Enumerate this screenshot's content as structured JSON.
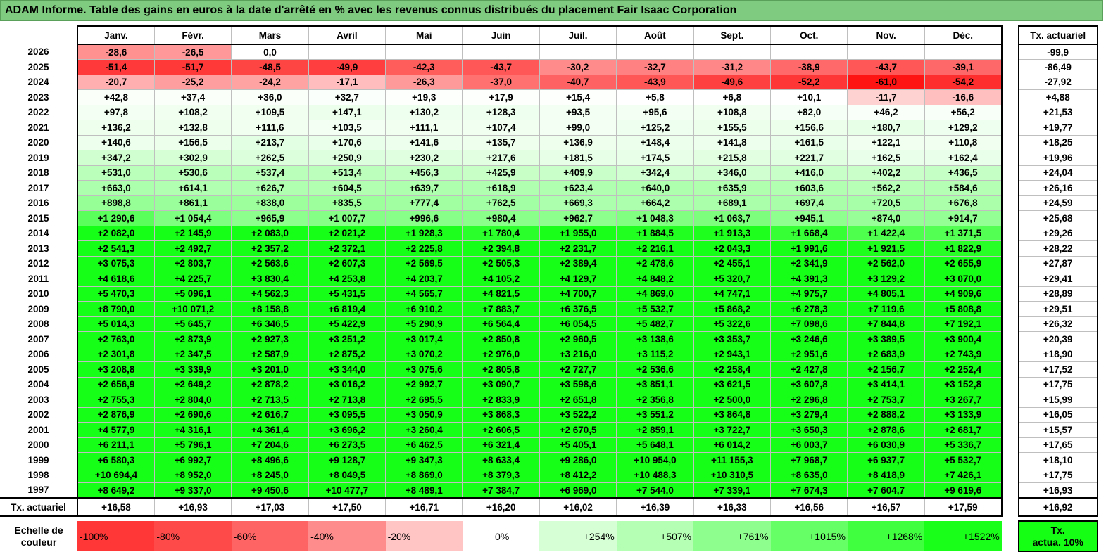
{
  "title": "ADAM Informe. Table des gains en euros à la date d'arrêté en % avec les revenus connus distribués du placement Fair Isaac Corporation",
  "months": [
    "Janv.",
    "Févr.",
    "Mars",
    "Avril",
    "Mai",
    "Juin",
    "Juil.",
    "Août",
    "Sept.",
    "Oct.",
    "Nov.",
    "Déc."
  ],
  "rate_header": "Tx. actuariel",
  "rows": [
    {
      "year": "2026",
      "values": [
        "-28,6",
        "-26,5",
        "0,0",
        "",
        "",
        "",
        "",
        "",
        "",
        "",
        "",
        ""
      ],
      "rate": "-99,9"
    },
    {
      "year": "2025",
      "values": [
        "-51,4",
        "-51,7",
        "-48,5",
        "-49,9",
        "-42,3",
        "-43,7",
        "-30,2",
        "-32,7",
        "-31,2",
        "-38,9",
        "-43,7",
        "-39,1"
      ],
      "rate": "-86,49"
    },
    {
      "year": "2024",
      "values": [
        "-20,7",
        "-25,2",
        "-24,2",
        "-17,1",
        "-26,3",
        "-37,0",
        "-40,7",
        "-43,9",
        "-49,6",
        "-52,2",
        "-61,0",
        "-54,2"
      ],
      "rate": "-27,92"
    },
    {
      "year": "2023",
      "values": [
        "+42,8",
        "+37,4",
        "+36,0",
        "+32,7",
        "+19,3",
        "+17,9",
        "+15,4",
        "+5,8",
        "+6,8",
        "+10,1",
        "-11,7",
        "-16,6"
      ],
      "rate": "+4,88"
    },
    {
      "year": "2022",
      "values": [
        "+97,8",
        "+108,2",
        "+109,5",
        "+147,1",
        "+130,2",
        "+128,3",
        "+93,5",
        "+95,6",
        "+108,8",
        "+82,0",
        "+46,2",
        "+56,2"
      ],
      "rate": "+21,53"
    },
    {
      "year": "2021",
      "values": [
        "+136,2",
        "+132,8",
        "+111,6",
        "+103,5",
        "+111,1",
        "+107,4",
        "+99,0",
        "+125,2",
        "+155,5",
        "+156,6",
        "+180,7",
        "+129,2"
      ],
      "rate": "+19,77"
    },
    {
      "year": "2020",
      "values": [
        "+140,6",
        "+156,5",
        "+213,7",
        "+170,6",
        "+141,6",
        "+135,7",
        "+136,9",
        "+148,4",
        "+141,8",
        "+161,5",
        "+122,1",
        "+110,8"
      ],
      "rate": "+18,25"
    },
    {
      "year": "2019",
      "values": [
        "+347,2",
        "+302,9",
        "+262,5",
        "+250,9",
        "+230,2",
        "+217,6",
        "+181,5",
        "+174,5",
        "+215,8",
        "+221,7",
        "+162,5",
        "+162,4"
      ],
      "rate": "+19,96"
    },
    {
      "year": "2018",
      "values": [
        "+531,0",
        "+530,6",
        "+537,4",
        "+513,4",
        "+456,3",
        "+425,9",
        "+409,9",
        "+342,4",
        "+346,0",
        "+416,0",
        "+402,2",
        "+436,5"
      ],
      "rate": "+24,04"
    },
    {
      "year": "2017",
      "values": [
        "+663,0",
        "+614,1",
        "+626,7",
        "+604,5",
        "+639,7",
        "+618,9",
        "+623,4",
        "+640,0",
        "+635,9",
        "+603,6",
        "+562,2",
        "+584,6"
      ],
      "rate": "+26,16"
    },
    {
      "year": "2016",
      "values": [
        "+898,8",
        "+861,1",
        "+838,0",
        "+835,5",
        "+777,4",
        "+762,5",
        "+669,3",
        "+664,2",
        "+689,1",
        "+697,4",
        "+720,5",
        "+676,8"
      ],
      "rate": "+24,59"
    },
    {
      "year": "2015",
      "values": [
        "+1 290,6",
        "+1 054,4",
        "+965,9",
        "+1 007,7",
        "+996,6",
        "+980,4",
        "+962,7",
        "+1 048,3",
        "+1 063,7",
        "+945,1",
        "+874,0",
        "+914,7"
      ],
      "rate": "+25,68"
    },
    {
      "year": "2014",
      "values": [
        "+2 082,0",
        "+2 145,9",
        "+2 083,0",
        "+2 021,2",
        "+1 928,3",
        "+1 780,4",
        "+1 955,0",
        "+1 884,5",
        "+1 913,3",
        "+1 668,4",
        "+1 422,4",
        "+1 371,5"
      ],
      "rate": "+29,26"
    },
    {
      "year": "2013",
      "values": [
        "+2 541,3",
        "+2 492,7",
        "+2 357,2",
        "+2 372,1",
        "+2 225,8",
        "+2 394,8",
        "+2 231,7",
        "+2 216,1",
        "+2 043,3",
        "+1 991,6",
        "+1 921,5",
        "+1 822,9"
      ],
      "rate": "+28,22"
    },
    {
      "year": "2012",
      "values": [
        "+3 075,3",
        "+2 803,7",
        "+2 563,6",
        "+2 607,3",
        "+2 569,5",
        "+2 505,3",
        "+2 389,4",
        "+2 478,6",
        "+2 455,1",
        "+2 341,9",
        "+2 562,0",
        "+2 655,9"
      ],
      "rate": "+27,87"
    },
    {
      "year": "2011",
      "values": [
        "+4 618,6",
        "+4 225,7",
        "+3 830,4",
        "+4 253,8",
        "+4 203,7",
        "+4 105,2",
        "+4 129,7",
        "+4 848,2",
        "+5 320,7",
        "+4 391,3",
        "+3 129,2",
        "+3 070,0"
      ],
      "rate": "+29,41"
    },
    {
      "year": "2010",
      "values": [
        "+5 470,3",
        "+5 096,1",
        "+4 562,3",
        "+5 431,5",
        "+4 565,7",
        "+4 821,5",
        "+4 700,7",
        "+4 869,0",
        "+4 747,1",
        "+4 975,7",
        "+4 805,1",
        "+4 909,6"
      ],
      "rate": "+28,89"
    },
    {
      "year": "2009",
      "values": [
        "+8 790,0",
        "+10 071,2",
        "+8 158,8",
        "+6 819,4",
        "+6 910,2",
        "+7 883,7",
        "+6 376,5",
        "+5 532,7",
        "+5 868,2",
        "+6 278,3",
        "+7 119,6",
        "+5 808,8"
      ],
      "rate": "+29,51"
    },
    {
      "year": "2008",
      "values": [
        "+5 014,3",
        "+5 645,7",
        "+6 346,5",
        "+5 422,9",
        "+5 290,9",
        "+6 564,4",
        "+6 054,5",
        "+5 482,7",
        "+5 322,6",
        "+7 098,6",
        "+7 844,8",
        "+7 192,1"
      ],
      "rate": "+26,32"
    },
    {
      "year": "2007",
      "values": [
        "+2 763,0",
        "+2 873,9",
        "+2 927,3",
        "+3 251,2",
        "+3 017,4",
        "+2 850,8",
        "+2 960,5",
        "+3 138,6",
        "+3 353,7",
        "+3 246,6",
        "+3 389,5",
        "+3 900,4"
      ],
      "rate": "+20,39"
    },
    {
      "year": "2006",
      "values": [
        "+2 301,8",
        "+2 347,5",
        "+2 587,9",
        "+2 875,2",
        "+3 070,2",
        "+2 976,0",
        "+3 216,0",
        "+3 115,2",
        "+2 943,1",
        "+2 951,6",
        "+2 683,9",
        "+2 743,9"
      ],
      "rate": "+18,90"
    },
    {
      "year": "2005",
      "values": [
        "+3 208,8",
        "+3 339,9",
        "+3 201,0",
        "+3 344,0",
        "+3 075,6",
        "+2 805,8",
        "+2 727,7",
        "+2 536,6",
        "+2 258,4",
        "+2 427,8",
        "+2 156,7",
        "+2 252,4"
      ],
      "rate": "+17,52"
    },
    {
      "year": "2004",
      "values": [
        "+2 656,9",
        "+2 649,2",
        "+2 878,2",
        "+3 016,2",
        "+2 992,7",
        "+3 090,7",
        "+3 598,6",
        "+3 851,1",
        "+3 621,5",
        "+3 607,8",
        "+3 414,1",
        "+3 152,8"
      ],
      "rate": "+17,75"
    },
    {
      "year": "2003",
      "values": [
        "+2 755,3",
        "+2 804,0",
        "+2 713,5",
        "+2 713,8",
        "+2 695,5",
        "+2 833,9",
        "+2 651,8",
        "+2 356,8",
        "+2 500,0",
        "+2 296,8",
        "+2 753,7",
        "+3 267,7"
      ],
      "rate": "+15,99"
    },
    {
      "year": "2002",
      "values": [
        "+2 876,9",
        "+2 690,6",
        "+2 616,7",
        "+3 095,5",
        "+3 050,9",
        "+3 868,3",
        "+3 522,2",
        "+3 551,2",
        "+3 864,8",
        "+3 279,4",
        "+2 888,2",
        "+3 133,9"
      ],
      "rate": "+16,05"
    },
    {
      "year": "2001",
      "values": [
        "+4 577,9",
        "+4 316,1",
        "+4 361,4",
        "+3 696,2",
        "+3 260,4",
        "+2 606,5",
        "+2 670,5",
        "+2 859,1",
        "+3 722,7",
        "+3 650,3",
        "+2 878,6",
        "+2 681,7"
      ],
      "rate": "+15,57"
    },
    {
      "year": "2000",
      "values": [
        "+6 211,1",
        "+5 796,1",
        "+7 204,6",
        "+6 273,5",
        "+6 462,5",
        "+6 321,4",
        "+5 405,1",
        "+5 648,1",
        "+6 014,2",
        "+6 003,7",
        "+6 030,9",
        "+5 336,7"
      ],
      "rate": "+17,65"
    },
    {
      "year": "1999",
      "values": [
        "+6 580,3",
        "+6 992,7",
        "+8 496,6",
        "+9 128,7",
        "+9 347,3",
        "+8 633,4",
        "+9 286,0",
        "+10 954,0",
        "+11 155,3",
        "+7 968,7",
        "+6 937,7",
        "+5 532,7"
      ],
      "rate": "+18,10"
    },
    {
      "year": "1998",
      "values": [
        "+10 694,4",
        "+8 952,0",
        "+8 245,0",
        "+8 049,5",
        "+8 869,0",
        "+8 379,3",
        "+8 412,2",
        "+10 488,3",
        "+10 310,5",
        "+8 635,0",
        "+8 418,9",
        "+7 426,1"
      ],
      "rate": "+17,75"
    },
    {
      "year": "1997",
      "values": [
        "+8 649,2",
        "+9 337,0",
        "+9 450,6",
        "+10 477,7",
        "+8 489,1",
        "+7 384,7",
        "+6 969,0",
        "+7 544,0",
        "+7 339,1",
        "+7 674,3",
        "+7 604,7",
        "+9 619,6"
      ],
      "rate": "+16,93"
    }
  ],
  "footer": {
    "label": "Tx. actuariel",
    "values": [
      "+16,58",
      "+16,93",
      "+17,03",
      "+17,50",
      "+16,71",
      "+16,20",
      "+16,02",
      "+16,39",
      "+16,33",
      "+16,56",
      "+16,57",
      "+17,59"
    ],
    "rate": "+16,92"
  },
  "legend": {
    "label_line1": "Echelle de",
    "label_line2": "couleur",
    "steps": [
      {
        "text": "-100%",
        "color": "#ff3737"
      },
      {
        "text": "-80%",
        "color": "#ff4a4a"
      },
      {
        "text": "-60%",
        "color": "#ff6464"
      },
      {
        "text": "-40%",
        "color": "#ff8c8c"
      },
      {
        "text": "-20%",
        "color": "#ffc4c4"
      },
      {
        "text": "0%",
        "color": "#ffffff"
      },
      {
        "text": "+254%",
        "color": "#d6ffd6"
      },
      {
        "text": "+507%",
        "color": "#b4ffb4"
      },
      {
        "text": "+761%",
        "color": "#8eff8e"
      },
      {
        "text": "+1015%",
        "color": "#66ff66"
      },
      {
        "text": "+1268%",
        "color": "#3fff3f"
      },
      {
        "text": "+1522%",
        "color": "#1aff1a"
      }
    ],
    "key_line1": "Tx.",
    "key_line2": "actua. 10%"
  }
}
